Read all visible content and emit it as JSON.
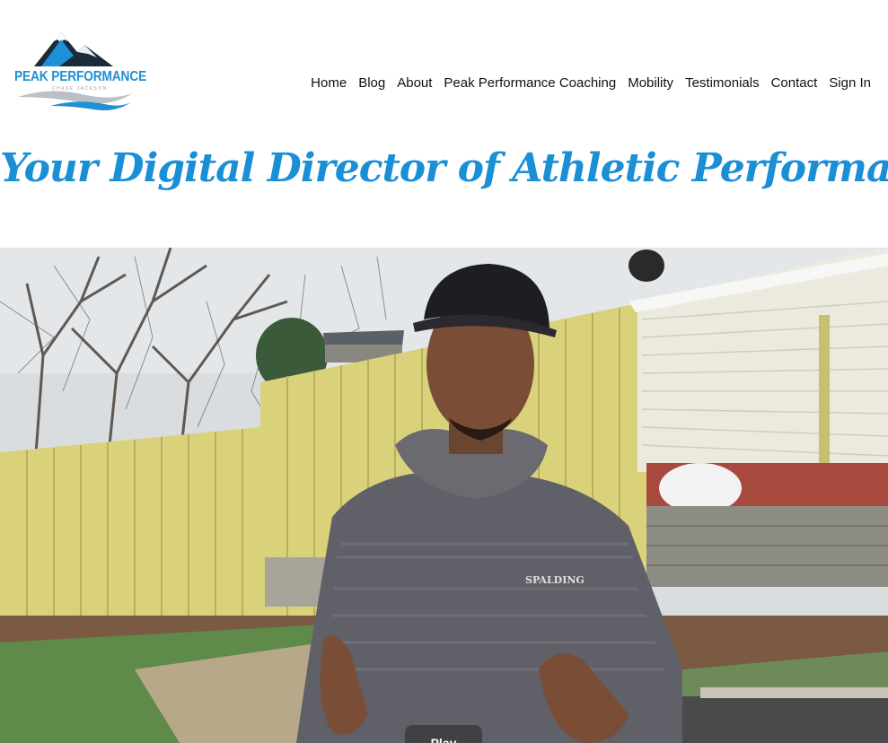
{
  "logo": {
    "title": "PEAK PERFORMANCE",
    "subtitle": "CHASE JACKSON"
  },
  "nav": {
    "items": [
      "Home",
      "Blog",
      "About",
      "Peak Performance Coaching",
      "Mobility",
      "Testimonials",
      "Contact",
      "Sign In"
    ]
  },
  "hero": {
    "tagline": "Your Digital Director of Athletic Performance"
  },
  "video": {
    "play_label": "Play",
    "shirt_logo": "SPALDING"
  },
  "colors": {
    "brand_blue": "#1a8fd6",
    "nav_text": "#111111",
    "fence_yellow": "#d9d27a",
    "house_siding": "#eceadf",
    "brick": "#a8493e",
    "shirt_gray": "#606068"
  },
  "icons": {
    "logo": "mountain-logo-icon"
  }
}
